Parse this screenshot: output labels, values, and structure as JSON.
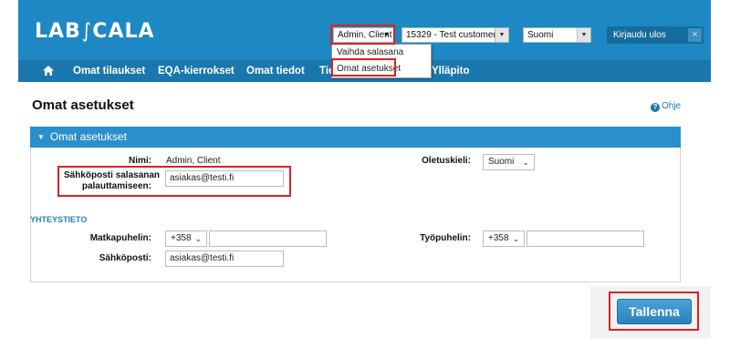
{
  "header": {
    "logo_prefix": "LAB",
    "logo_slash": "∫",
    "logo_suffix": "CALA",
    "user_select": "Admin, Client",
    "customer_select": "15329 - Test customer",
    "language_select": "Suomi",
    "logout_label": "Kirjaudu ulos",
    "logout_close": "×"
  },
  "nav": {
    "items": [
      "Omat tilaukset",
      "EQA-kierrokset",
      "Omat tiedot",
      "Tie",
      "Ylläpito"
    ]
  },
  "user_menu": {
    "items": [
      "Vaihda salasana",
      "Omat asetukset"
    ]
  },
  "page": {
    "title": "Omat asetukset",
    "help_label": "Ohje",
    "help_icon_glyph": "?"
  },
  "panel": {
    "title": "Omat asetukset",
    "name_label": "Nimi:",
    "name_value": "Admin, Client",
    "reset_email_label_line1": "Sähköposti salasanan",
    "reset_email_label_line2": "palauttamiseen:",
    "reset_email_value": "asiakas@testi.fi",
    "default_language_label": "Oletuskieli:",
    "default_language_value": "Suomi",
    "contact_section": "YHTEYSTIETO",
    "mobile_label": "Matkapuhelin:",
    "mobile_prefix": "+358",
    "mobile_value": "",
    "work_phone_label": "Työpuhelin:",
    "work_phone_prefix": "+358",
    "work_phone_value": "",
    "email_label": "Sähköposti:",
    "email_value": "asiakas@testi.fi"
  },
  "actions": {
    "save_label": "Tallenna"
  },
  "colors": {
    "header_bg": "#1e88c4",
    "nav_bg": "#1a77ad",
    "panel_header_bg": "#2b8fcb",
    "highlight": "#dd2222",
    "section_label": "#2b7fb8"
  }
}
